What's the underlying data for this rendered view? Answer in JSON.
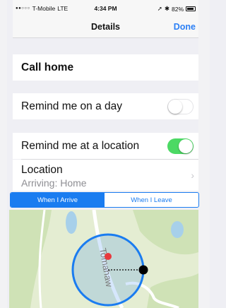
{
  "status_bar": {
    "carrier": "T-Mobile",
    "network": "LTE",
    "time": "4:34 PM",
    "battery": "82%"
  },
  "nav": {
    "title": "Details",
    "done_label": "Done"
  },
  "task": {
    "title": "Call home"
  },
  "remind_on_day": {
    "label": "Remind me on a day",
    "enabled": false
  },
  "remind_at_location": {
    "label": "Remind me at a location",
    "enabled": true
  },
  "location": {
    "label": "Location",
    "value": "Arriving: Home"
  },
  "segments": {
    "arrive_label": "When I Arrive",
    "leave_label": "When I Leave",
    "selected": "arrive"
  },
  "map": {
    "street_label": "Tomahaw",
    "colors": {
      "land": "#e4edd2",
      "forest": "#cfe2b6",
      "water": "#a7d0ea",
      "road": "#ffffff",
      "geofence": "#1a7cf0",
      "pin": "#e8383d"
    }
  },
  "colors": {
    "accent": "#2b7ff5",
    "toggle_on": "#4cd964"
  }
}
